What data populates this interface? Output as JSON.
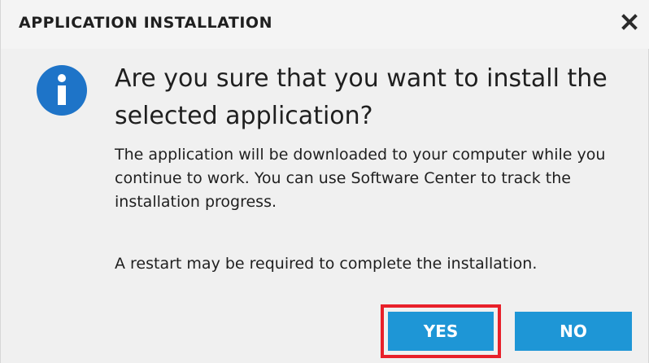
{
  "dialog": {
    "title": "APPLICATION INSTALLATION",
    "close_icon": "close-icon",
    "info_icon": "info-icon",
    "heading": "Are you sure that you want to install the selected application?",
    "body": "The application will be downloaded to your computer while you continue to work. You can use Software Center to track the installation progress.",
    "restart_note": "A restart may be required to complete the installation.",
    "buttons": {
      "yes_label": "YES",
      "no_label": "NO"
    }
  },
  "colors": {
    "button_bg": "#1e96d6",
    "info_icon_bg": "#1e74c8",
    "highlight_border": "#e8202a",
    "dialog_bg": "#f0f0f0"
  }
}
